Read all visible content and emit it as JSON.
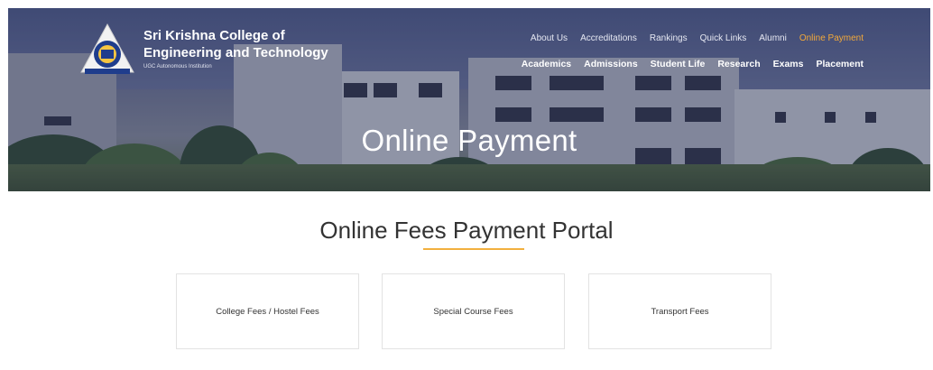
{
  "brand": {
    "name_line1": "Sri Krishna College of",
    "name_line2": "Engineering and Technology",
    "tagline": "UGC Autonomous Institution"
  },
  "nav_top": [
    "About Us",
    "Accreditations",
    "Rankings",
    "Quick Links",
    "Alumni",
    "Online Payment"
  ],
  "nav_bottom": [
    "Academics",
    "Admissions",
    "Student Life",
    "Research",
    "Exams",
    "Placement"
  ],
  "hero": {
    "title": "Online Payment"
  },
  "portal": {
    "title": "Online Fees Payment Portal",
    "options": [
      "College Fees / Hostel Fees",
      "Special Course Fees",
      "Transport Fees"
    ]
  },
  "colors": {
    "accent": "#f3a93a",
    "text": "#333333",
    "card_border": "#e3e3e3"
  }
}
